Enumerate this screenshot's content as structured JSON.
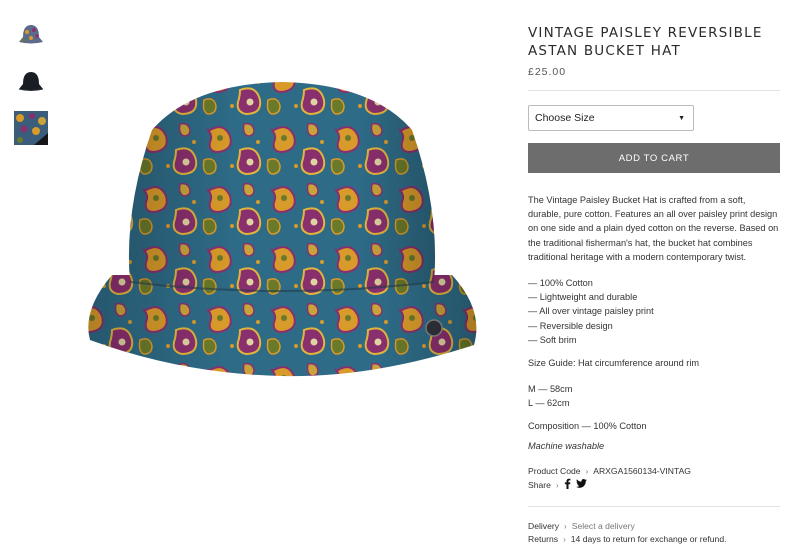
{
  "product": {
    "title": "VINTAGE PAISLEY REVERSIBLE ASTAN BUCKET HAT",
    "price": "£25.00",
    "size_select": {
      "selected": "Choose Size"
    },
    "add_to_cart": "ADD TO CART",
    "description": "The Vintage Paisley Bucket Hat is crafted from a soft, durable, pure cotton. Features an all over paisley print design on one side and a plain dyed cotton on the reverse. Based on the traditional fisherman's hat, the bucket hat combines traditional heritage with a modern contemporary twist.",
    "features": [
      "— 100% Cotton",
      "— Lightweight and durable",
      "— All over vintage paisley print",
      "— Reversible design",
      "— Soft brim"
    ],
    "size_guide": "Size Guide: Hat circumference around rim",
    "sizes": [
      "M — 58cm",
      "L — 62cm"
    ],
    "composition": "Composition — 100% Cotton",
    "care": "Machine washable",
    "product_code_label": "Product Code",
    "product_code": "ARXGA1560134-VINTAG",
    "share_label": "Share",
    "delivery_label": "Delivery",
    "delivery_value": "Select a delivery",
    "returns_label": "Returns",
    "returns_value": "14 days to return for exchange or refund."
  },
  "icons": {
    "facebook": "facebook-icon",
    "twitter": "twitter-icon",
    "chevron": "chevron-right-icon",
    "caret": "caret-down-icon"
  },
  "colors": {
    "button_bg": "#6d6d6d",
    "paisley_base": "#2e6b86",
    "paisley_accent_1": "#d89a2a",
    "paisley_accent_2": "#8a2f6e",
    "paisley_accent_3": "#6b7a2a"
  }
}
